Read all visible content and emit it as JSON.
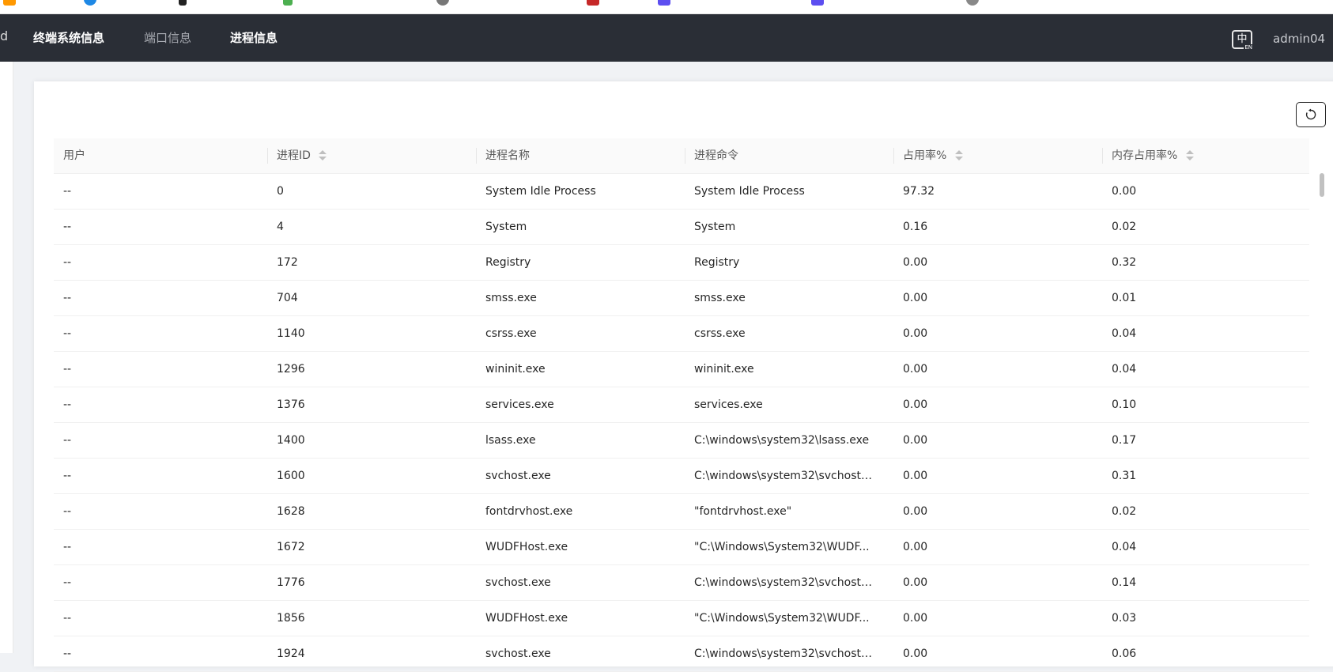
{
  "header": {
    "brand_fragment": "d",
    "nav": [
      {
        "label": "终端系统信息"
      },
      {
        "label": "端口信息"
      },
      {
        "label": "进程信息"
      }
    ],
    "lang_label": "中",
    "lang_sub": "EN",
    "user": "admin04"
  },
  "table": {
    "columns": [
      {
        "label": "用户"
      },
      {
        "label": "进程ID"
      },
      {
        "label": "进程名称"
      },
      {
        "label": "进程命令"
      },
      {
        "label": "占用率%"
      },
      {
        "label": "内存占用率%"
      }
    ],
    "rows": [
      {
        "user": "--",
        "pid": "0",
        "name": "System Idle Process",
        "cmd": "System Idle Process",
        "cpu": "97.32",
        "mem": "0.00"
      },
      {
        "user": "--",
        "pid": "4",
        "name": "System",
        "cmd": "System",
        "cpu": "0.16",
        "mem": "0.02"
      },
      {
        "user": "--",
        "pid": "172",
        "name": "Registry",
        "cmd": "Registry",
        "cpu": "0.00",
        "mem": "0.32"
      },
      {
        "user": "--",
        "pid": "704",
        "name": "smss.exe",
        "cmd": "smss.exe",
        "cpu": "0.00",
        "mem": "0.01"
      },
      {
        "user": "--",
        "pid": "1140",
        "name": "csrss.exe",
        "cmd": "csrss.exe",
        "cpu": "0.00",
        "mem": "0.04"
      },
      {
        "user": "--",
        "pid": "1296",
        "name": "wininit.exe",
        "cmd": "wininit.exe",
        "cpu": "0.00",
        "mem": "0.04"
      },
      {
        "user": "--",
        "pid": "1376",
        "name": "services.exe",
        "cmd": "services.exe",
        "cpu": "0.00",
        "mem": "0.10"
      },
      {
        "user": "--",
        "pid": "1400",
        "name": "lsass.exe",
        "cmd": "C:\\windows\\system32\\lsass.exe",
        "cpu": "0.00",
        "mem": "0.17"
      },
      {
        "user": "--",
        "pid": "1600",
        "name": "svchost.exe",
        "cmd": "C:\\windows\\system32\\svchost....",
        "cpu": "0.00",
        "mem": "0.31"
      },
      {
        "user": "--",
        "pid": "1628",
        "name": "fontdrvhost.exe",
        "cmd": "\"fontdrvhost.exe\"",
        "cpu": "0.00",
        "mem": "0.02"
      },
      {
        "user": "--",
        "pid": "1672",
        "name": "WUDFHost.exe",
        "cmd": "\"C:\\Windows\\System32\\WUDF...",
        "cpu": "0.00",
        "mem": "0.04"
      },
      {
        "user": "--",
        "pid": "1776",
        "name": "svchost.exe",
        "cmd": "C:\\windows\\system32\\svchost....",
        "cpu": "0.00",
        "mem": "0.14"
      },
      {
        "user": "--",
        "pid": "1856",
        "name": "WUDFHost.exe",
        "cmd": "\"C:\\Windows\\System32\\WUDF...",
        "cpu": "0.00",
        "mem": "0.03"
      },
      {
        "user": "--",
        "pid": "1924",
        "name": "svchost.exe",
        "cmd": "C:\\windows\\system32\\svchost....",
        "cpu": "0.00",
        "mem": "0.06"
      }
    ]
  },
  "colors": {
    "topbar": "#2a2e36",
    "table_header": "#fafafa"
  }
}
